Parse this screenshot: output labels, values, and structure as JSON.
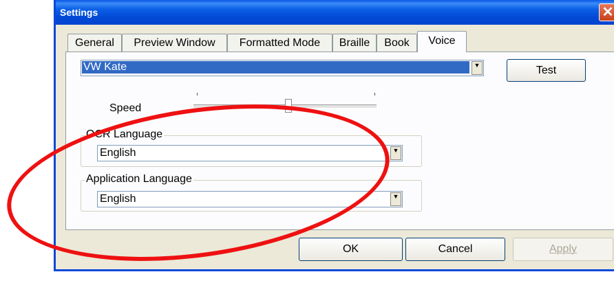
{
  "window": {
    "title": "Settings",
    "close_glyph": "✕"
  },
  "tabs": [
    {
      "label": "General"
    },
    {
      "label": "Preview Window"
    },
    {
      "label": "Formatted Mode"
    },
    {
      "label": "Braille"
    },
    {
      "label": "Book"
    },
    {
      "label": "Voice"
    }
  ],
  "voice": {
    "selected": "VW Kate",
    "test_label": "Test",
    "speed_label": "Speed",
    "speed_level": 0.52
  },
  "ocr_language": {
    "label": "OCR Language",
    "value": "English"
  },
  "app_language": {
    "label": "Application Language",
    "value": "English"
  },
  "buttons": {
    "ok": "OK",
    "cancel": "Cancel",
    "apply": "Apply"
  },
  "colors": {
    "titlebar": "#0a58e8",
    "highlight": "#316ac5",
    "annotation": "#ee1111"
  },
  "icons": {
    "dropdown": "▼",
    "close": "close-icon"
  }
}
